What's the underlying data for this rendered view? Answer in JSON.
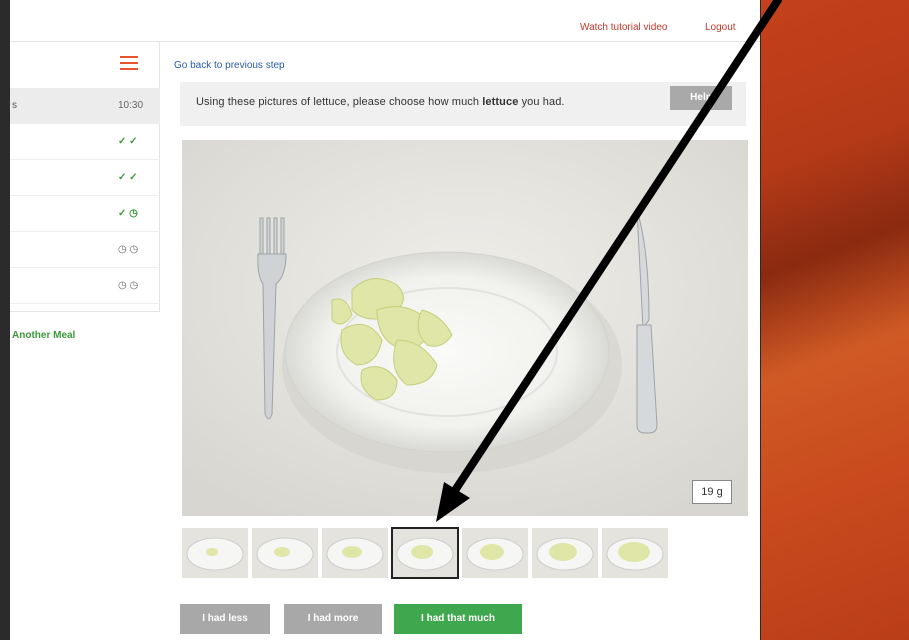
{
  "topbar": {
    "video_link": "Watch tutorial video",
    "logout_link": "Logout"
  },
  "sidebar": {
    "rows": [
      {
        "left": "s",
        "right": "10:30",
        "active": true
      },
      {
        "left": "",
        "right": "✓ ✓"
      },
      {
        "left": "",
        "right": "✓ ✓"
      },
      {
        "left": "",
        "right": "✓ ◷"
      },
      {
        "left": "",
        "right": "◷ ◷"
      },
      {
        "left": "",
        "right": "◷ ◷"
      }
    ],
    "another_meal": "Another Meal"
  },
  "main": {
    "back_link": "Go back to previous step",
    "prompt_prefix": "Using these pictures of lettuce, please choose how much ",
    "prompt_bold": "lettuce",
    "prompt_suffix": " you had.",
    "help_label": "Help",
    "weight": "19 g",
    "selected_thumbnail": 4,
    "thumbnail_count": 7
  },
  "buttons": {
    "less": "I had less",
    "more": "I had more",
    "that": "I had that much"
  },
  "colors": {
    "accent": "#e8542b",
    "link": "#2a5ba8",
    "green": "#3fa84e",
    "disabled": "#a8a8a8",
    "arrow": "#000000"
  }
}
